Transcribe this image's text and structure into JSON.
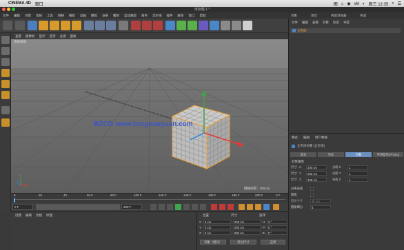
{
  "mac": {
    "app": "CINEMA 4D",
    "menu": [
      "窗口"
    ],
    "status_right": [
      "图",
      "⌂",
      "◉",
      "vkl",
      "◐",
      "周三",
      "12:35",
      "⌕",
      "☰"
    ],
    "clock": "周三 12:35"
  },
  "window_title": "未标题 1 *",
  "c4d_menu": [
    "文件",
    "编辑",
    "创建",
    "选择",
    "工具",
    "网格",
    "捕捉",
    "动画",
    "模拟",
    "渲染",
    "雕刻",
    "运动跟踪",
    "角色",
    "流水线",
    "插件",
    "脚本",
    "窗口",
    "帮助"
  ],
  "layout_label": "界面",
  "layout_value": "启动",
  "viewport": {
    "menu": [
      "查看",
      "摄像机",
      "显示",
      "选项",
      "过滤",
      "面板"
    ],
    "camera": "透视视图",
    "watermark": "BZCG  www.bzcgxueyuan.com",
    "grid_spacing": "网格间距：100 cm"
  },
  "timeline": {
    "ticks": [
      "0",
      "10",
      "20",
      "30",
      "40",
      "50",
      "60",
      "70",
      "80",
      "90"
    ],
    "end_frame": "0 F",
    "tick_labels": [
      "0",
      "20",
      "40",
      "60 F",
      "80 F",
      "100 F",
      "120 F",
      "140 F",
      "160 F",
      "180 F",
      "200 F"
    ],
    "frame_right": "200 F"
  },
  "playback": {
    "current": "0 F",
    "min": "0 F",
    "max": "200 F",
    "preview_max": "200 F"
  },
  "materials": {
    "menu": [
      "创建",
      "编辑",
      "功能",
      "纹理"
    ]
  },
  "coords": {
    "headers": [
      "位置",
      "尺寸",
      "旋转"
    ],
    "rows": [
      {
        "axis": "X",
        "pos": "0 cm",
        "size": "200 cm",
        "rot_label": "H",
        "rot": "0 °"
      },
      {
        "axis": "Y",
        "pos": "0 cm",
        "size": "200 cm",
        "rot_label": "P",
        "rot": "0 °"
      },
      {
        "axis": "Z",
        "pos": "0 cm",
        "size": "200 cm",
        "rot_label": "B",
        "rot": "0 °"
      }
    ],
    "mode": "对象（相对）",
    "size_mode": "绝对尺寸",
    "apply": "应用"
  },
  "objects": {
    "tabs": [
      "文件",
      "编辑",
      "查看",
      "对象",
      "标签",
      "书签"
    ],
    "panel_tabs": [
      "对象",
      "场次",
      "内容浏览器",
      "构造"
    ],
    "items": [
      {
        "name": "立方体"
      }
    ]
  },
  "attributes": {
    "menu": [
      "模式",
      "编辑",
      "用户数据"
    ],
    "object_title": "立方体对象 [立方体]",
    "tabs": [
      "基本",
      "坐标",
      "对象",
      "平滑着色(Phong)"
    ],
    "section": "对象属性",
    "rows": [
      {
        "label": "尺寸 . X",
        "value": "200 cm",
        "seg_label": "分段 X",
        "seg": "1"
      },
      {
        "label": "尺寸 . Y",
        "value": "200 cm",
        "seg_label": "分段 Y",
        "seg": "1"
      },
      {
        "label": "尺寸 . Z",
        "value": "200 cm",
        "seg_label": "分段 Z",
        "seg": "1"
      }
    ],
    "separate": "分离表面",
    "fillet": "圆角",
    "fillet_radius_label": "圆角半径",
    "fillet_radius": "40 cm",
    "fillet_seg_label": "圆角细分",
    "fillet_seg": "5"
  },
  "colors": {
    "accent": "#ffb74d",
    "axis_x": "#e53935",
    "axis_y": "#43a047",
    "axis_z": "#1e88e5"
  }
}
